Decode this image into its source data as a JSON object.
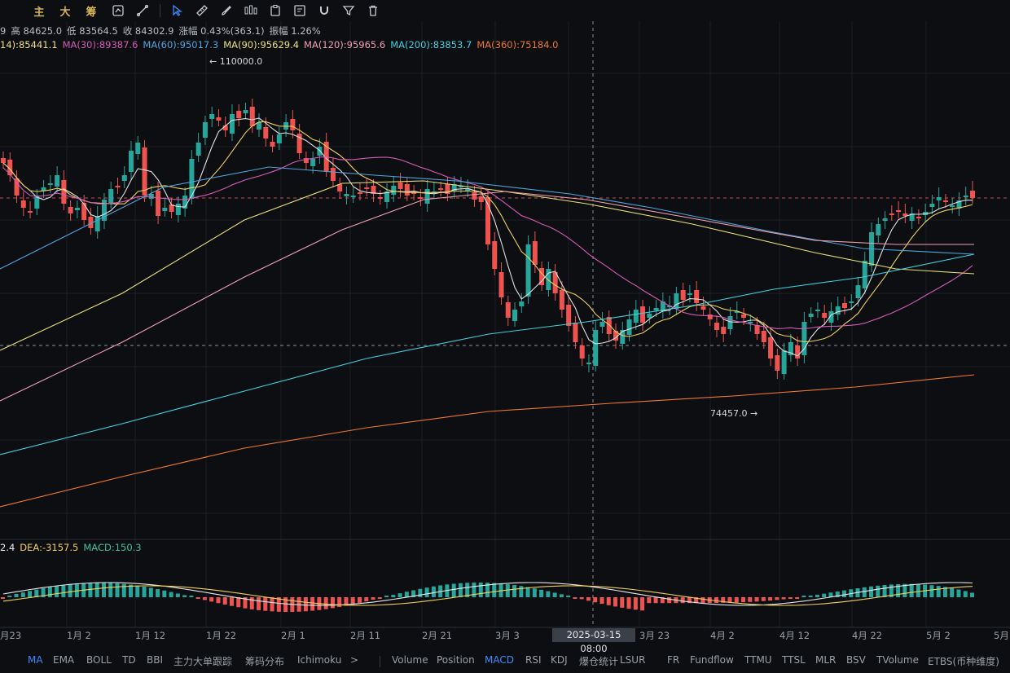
{
  "toolbar": {
    "labels": [
      "主",
      "大",
      "筹"
    ],
    "icons": [
      "replay-icon",
      "line-tool-icon",
      "cursor-icon",
      "ruler-icon",
      "brush-icon",
      "candle-settings-icon",
      "clipboard-icon",
      "note-icon",
      "magnet-icon",
      "filter-icon",
      "trash-icon"
    ]
  },
  "ohlc": {
    "prefix": "9",
    "high": "高 84625.0",
    "low": "低 83564.5",
    "close": "收 84302.9",
    "change": "涨幅 0.43%(363.1)",
    "amplitude": "振幅 1.26%"
  },
  "ma_legend": [
    {
      "text": "14):85441.1",
      "color": "#f0e08a"
    },
    {
      "text": "MA(30):89387.6",
      "color": "#d45ab8"
    },
    {
      "text": "MA(60):95017.3",
      "color": "#4ea4e0"
    },
    {
      "text": "MA(90):95629.4",
      "color": "#e8e07a"
    },
    {
      "text": "MA(120):95965.6",
      "color": "#f0a0b0"
    },
    {
      "text": "MA(200):83853.7",
      "color": "#3fd0e0"
    },
    {
      "text": "MA(360):75184.0",
      "color": "#f07830"
    }
  ],
  "markers": {
    "high": "← 110000.0",
    "low": "74457.0 →"
  },
  "macd_legend": [
    {
      "text": "2.4",
      "color": "#e8e8e8"
    },
    {
      "text": "DEA:-3157.5",
      "color": "#f0d060"
    },
    {
      "text": "MACD:150.3",
      "color": "#3fc0a0"
    }
  ],
  "xaxis": {
    "labels": [
      "月23",
      "1月 2",
      "1月 12",
      "1月 22",
      "2月 1",
      "2月 11",
      "2月 21",
      "3月 3",
      "3月 23",
      "4月 2",
      "4月 12",
      "4月 22",
      "5月 2",
      "5月"
    ],
    "crosshair_label": "2025-03-15 08:00"
  },
  "bottom_tabs": {
    "left": [
      "MA",
      "EMA",
      "BOLL",
      "TD",
      "BBI",
      "主力大单跟踪",
      "筹码分布",
      "Ichimoku",
      ">"
    ],
    "right": [
      "Volume",
      "Position",
      "MACD",
      "RSI",
      "KDJ",
      "爆仓统计",
      "LSUR",
      "FR",
      "Fundflow",
      "TTMU",
      "TTSL",
      "MLR",
      "BSV",
      "TVolume",
      "ETBS(币种维度)"
    ],
    "active_left": "MA",
    "active_right": "MACD"
  },
  "colors": {
    "up": "#26a69a",
    "down": "#ef5350",
    "active_tab": "#3b8bff",
    "ma5": "#e0e0e0",
    "ma10": "#f0d060"
  },
  "chart_data": {
    "type": "candlestick",
    "y_markers": {
      "max": 110000.0,
      "min": 74457.0
    },
    "current_close": 84302.9,
    "macd": {
      "DEA": -3157.5,
      "MACD": 150.3
    }
  }
}
